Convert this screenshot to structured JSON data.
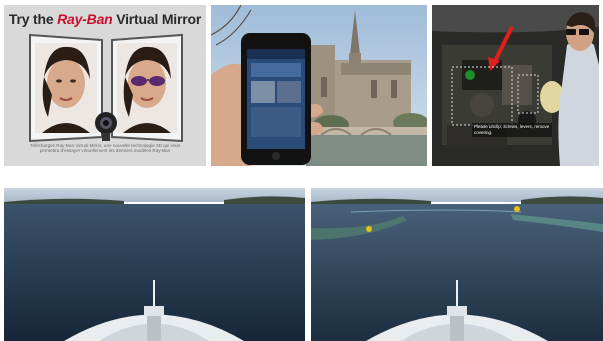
{
  "ray_ban": {
    "title_prefix": "Try the",
    "title_brand": "Ray-Ban",
    "title_suffix": "Virtual Mirror",
    "caption": "Téléchargez Ray-Ban Virtual Mirror, une nouvelle technologie 3D qui vous permettra d'essayer virtuellement les derniers modèles Ray-Ban"
  },
  "engine": {
    "annotation": "Please unclip, screws, levers, remove covering."
  },
  "colors": {
    "mirror_bg": "#d9d9d9",
    "sky": "#b9cde0",
    "sea": "#21344a",
    "hull": "#e8ecef",
    "marker": "#e3c21a"
  }
}
